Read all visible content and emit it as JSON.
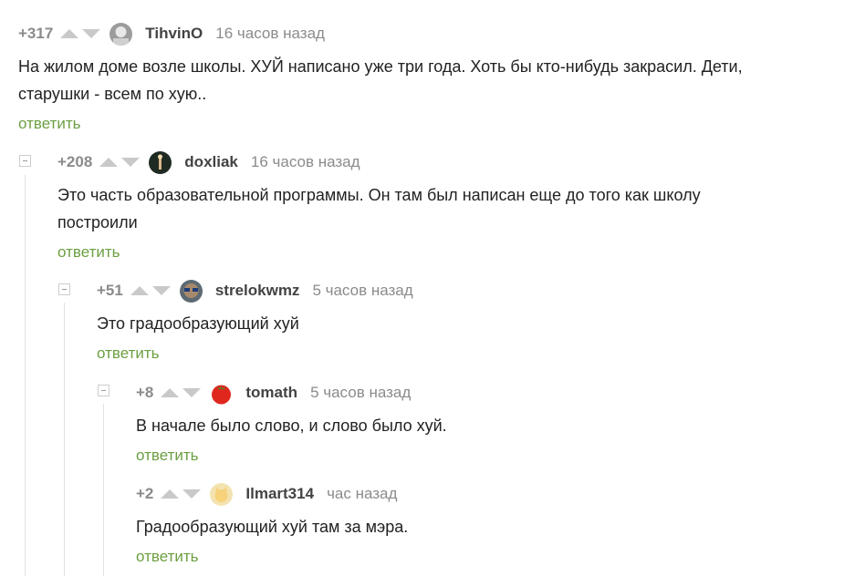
{
  "comments": [
    {
      "rating": "+317",
      "author": "TihvinO",
      "time": "16 часов назад",
      "text_lines": [
        "На жилом доме возле школы. ХУЙ написано уже три года. Хоть бы кто-нибудь закрасил. Дети,",
        "старушки - всем по хую.."
      ],
      "reply": "ответить",
      "avatar_color": "#9c9c9c"
    },
    {
      "rating": "+208",
      "author": "doxliak",
      "time": "16 часов назад",
      "text_lines": [
        "Это часть образовательной программы. Он там был написан еще до того как школу",
        "построили"
      ],
      "reply": "ответить",
      "avatar_color": "#1f2a22"
    },
    {
      "rating": "+51",
      "author": "strelokwmz",
      "time": "5 часов назад",
      "text_lines": [
        "Это градообразующий хуй"
      ],
      "reply": "ответить",
      "avatar_color": "#5d6a73"
    },
    {
      "rating": "+8",
      "author": "tomath",
      "time": "5 часов назад",
      "text_lines": [
        "В начале было слово, и слово было хуй."
      ],
      "reply": "ответить",
      "avatar_color": "#e0271e"
    },
    {
      "rating": "+2",
      "author": "Ilmart314",
      "time": "час назад",
      "text_lines": [
        "Градообразующий хуй там за мэра."
      ],
      "reply": "ответить",
      "avatar_color": "#f3e3b0"
    }
  ]
}
